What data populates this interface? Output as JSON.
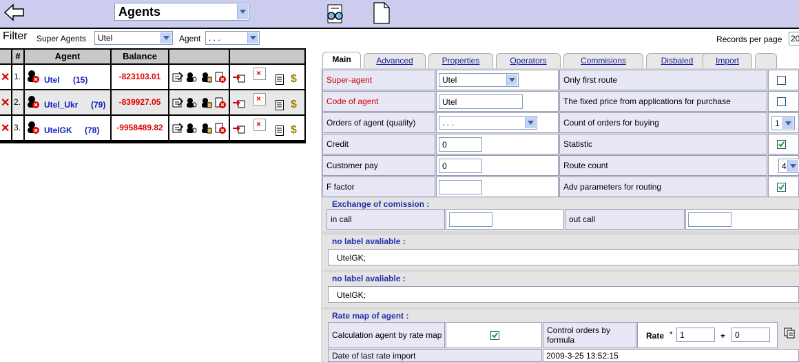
{
  "header": {
    "title": "Agents"
  },
  "filter": {
    "label": "Filter",
    "super_agents_label": "Super Agents",
    "super_agents_value": "Utel",
    "agent_label": "Agent",
    "agent_value": ". . .",
    "records_per_page_label": "Records per page",
    "records_per_page_value": "20"
  },
  "table": {
    "headers": [
      "#",
      "Agent",
      "Balance"
    ],
    "rows": [
      {
        "num": "1.",
        "name": "Utel",
        "count": "(15)",
        "balance": "-823103.01"
      },
      {
        "num": "2.",
        "name": "Utel_Ukr",
        "count": "(79)",
        "balance": "-839927.05"
      },
      {
        "num": "3.",
        "name": "UtelGK",
        "count": "(78)",
        "balance": "-9958489.82"
      }
    ]
  },
  "tabs": [
    "Main",
    "Advanced",
    "Properties",
    "Operators",
    "Commisions",
    "Disbaled",
    "Import",
    ""
  ],
  "form": {
    "super_agent_label": "Super-agent",
    "super_agent_value": "Utel",
    "code_label": "Code of agent",
    "code_value": "Utel",
    "orders_label": "Orders of agent (quality)",
    "orders_value": ". . .",
    "credit_label": "Credit",
    "credit_value": "0",
    "customer_pay_label": "Customer pay",
    "customer_pay_value": "0",
    "f_factor_label": "F factor",
    "f_factor_value": "",
    "only_first_route_label": "Only first route",
    "only_first_route_checked": false,
    "fixed_price_label": "The fixed price from applications for purchase",
    "fixed_price_checked": false,
    "count_orders_label": "Count of orders for buying",
    "count_orders_value": "1",
    "statistic_label": "Statistic",
    "statistic_checked": true,
    "route_count_label": "Route count",
    "route_count_value": "4",
    "adv_params_label": "Adv parameters for routing",
    "adv_params_checked": true
  },
  "exchange": {
    "title": "Exchange of comission",
    "in_call_label": "in call",
    "in_call_value": "",
    "out_call_label": "out call",
    "out_call_value": ""
  },
  "label_sections": [
    {
      "title": "no label avaliable",
      "value": "UtelGK;"
    },
    {
      "title": "no label avaliable",
      "value": "UtelGK;"
    }
  ],
  "rate_map": {
    "title": "Rate map of agent",
    "calc_label": "Calculation agent by rate map",
    "calc_checked": true,
    "control_label": "Control orders by formula",
    "rate_label": "Rate",
    "rate_star": "*",
    "rate_value": "1",
    "plus": "+",
    "plus_value": "0",
    "last_import_label": "Date of last rate import",
    "last_import_value": "2009-3-25 13:52:15"
  },
  "colors": {
    "topbar": "#ccccee",
    "accent_red": "#cc0000",
    "link_blue": "#1a1aa6"
  }
}
